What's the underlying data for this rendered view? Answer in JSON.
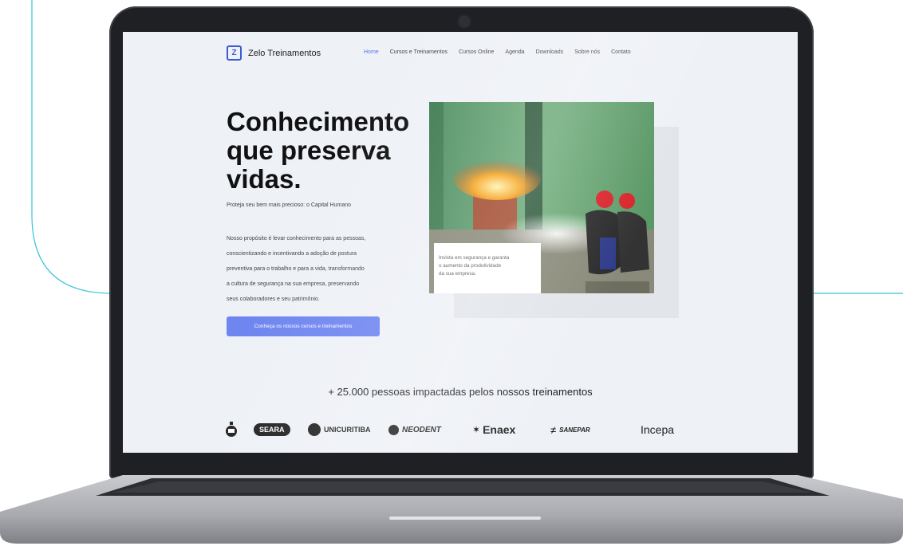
{
  "nav": {
    "logo_text": "Zelo Treinamentos",
    "logo_glyph": "Z",
    "links": [
      {
        "label": "Home",
        "active": true
      },
      {
        "label": "Cursos e Treinamentos"
      },
      {
        "label": "Cursos Online"
      },
      {
        "label": "Agenda"
      },
      {
        "label": "Downloads"
      },
      {
        "label": "Sobre nós"
      },
      {
        "label": "Contato"
      }
    ]
  },
  "hero": {
    "title_line1": "Conhecimento",
    "title_line2": "que preserva",
    "title_line3": "vidas.",
    "subtitle": "Proteja seu bem mais precioso: o Capital Humano",
    "description_lines": [
      "Nosso propósito é levar conhecimento para as pessoas,",
      "conscientizando e incentivando a adoção de postura",
      "preventiva para o trabalho e para a vida, transformando",
      "a cultura de segurança na sua empresa, preservando",
      "seus colaboradores e seu patrimônio."
    ],
    "cta_label": "Conheça os nossos cursos e treinamentos",
    "photo_caption_lines": [
      "Invista em segurança e garanta",
      "o aumento da produtividade",
      "da sua empresa."
    ]
  },
  "stats": {
    "heading": "+ 25.000 pessoas impactadas pelos nossos treinamentos"
  },
  "partners": [
    "SEARA",
    "UNICURITIBA",
    "NEODENT",
    "Enaex",
    "SANEPAR",
    "Incepa"
  ],
  "colors": {
    "accent": "#5b73e8",
    "cta": "#6f86f0",
    "screen_bg": "#eef1f6",
    "curve": "#35c3d8"
  }
}
